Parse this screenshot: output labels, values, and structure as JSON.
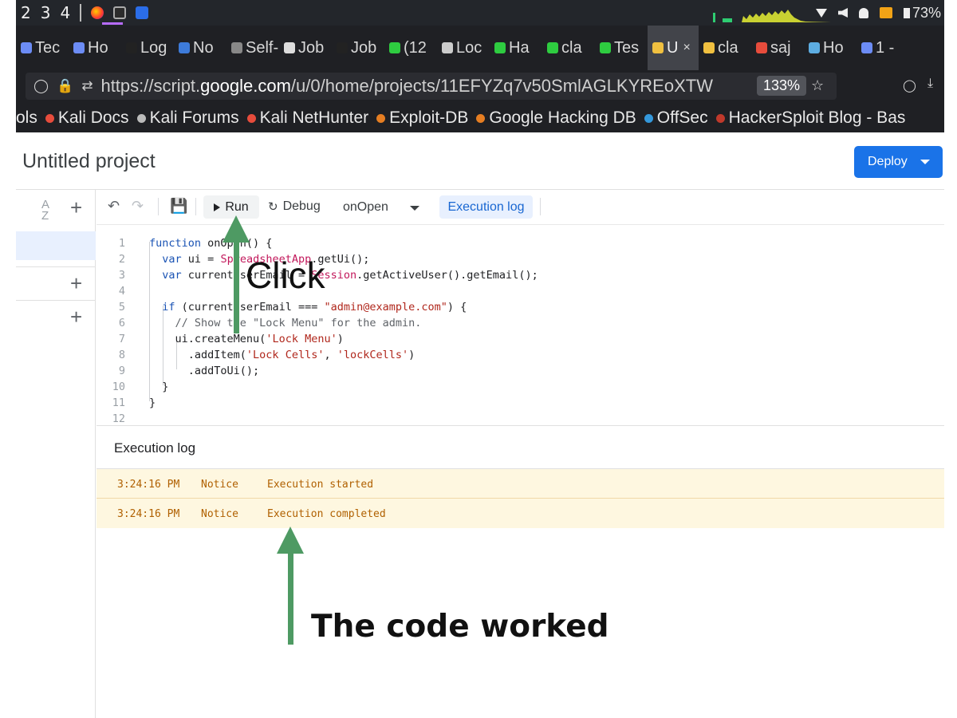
{
  "os_bar": {
    "workspaces": [
      "2",
      "3",
      "4"
    ],
    "battery": "73%"
  },
  "tabs": [
    {
      "label": "Tec",
      "color": "#6c8cf5"
    },
    {
      "label": "Ho",
      "color": "#6c8cf5"
    },
    {
      "label": "Log",
      "color": "#222"
    },
    {
      "label": "No",
      "color": "#3d7bd9"
    },
    {
      "label": "Self-",
      "color": "#888"
    },
    {
      "label": "Job",
      "color": "#ddd"
    },
    {
      "label": "Job",
      "color": "#222"
    },
    {
      "label": "(12",
      "color": "#2ecc40"
    },
    {
      "label": "Loc",
      "color": "#ccc"
    },
    {
      "label": "Ha",
      "color": "#2ecc40"
    },
    {
      "label": "cla",
      "color": "#2ecc40"
    },
    {
      "label": "Tes",
      "color": "#2ecc40"
    },
    {
      "label": "U",
      "color": "#f0c040",
      "active": true,
      "close": "×"
    },
    {
      "label": "cla",
      "color": "#f0c040"
    },
    {
      "label": "saj",
      "color": "#e74c3c"
    },
    {
      "label": "Ho",
      "color": "#5dade2"
    },
    {
      "label": "1 -",
      "color": "#6c8cf5"
    }
  ],
  "url_bar": {
    "prefix": "https://script.",
    "domain": "google.com",
    "path": "/u/0/home/projects/11EFYZq7v50SmlAGLKYREoXTW",
    "zoom": "133%"
  },
  "bookmarks": [
    {
      "label": "ols",
      "color": ""
    },
    {
      "label": "Kali Docs",
      "color": "#e74c3c"
    },
    {
      "label": "Kali Forums",
      "color": "#bbb"
    },
    {
      "label": "Kali NetHunter",
      "color": "#e74c3c"
    },
    {
      "label": "Exploit-DB",
      "color": "#e67e22"
    },
    {
      "label": "Google Hacking DB",
      "color": "#e67e22"
    },
    {
      "label": "OffSec",
      "color": "#3498db"
    },
    {
      "label": "HackerSploit Blog - Bas",
      "color": "#c0392b"
    }
  ],
  "app": {
    "project_title": "Untitled project",
    "deploy_label": "Deploy",
    "toolbar": {
      "run_label": "Run",
      "debug_label": "Debug",
      "function_name": "onOpen",
      "exec_log_label": "Execution log"
    }
  },
  "code_lines": [
    {
      "n": "1",
      "html": "<span class='kw'>function</span> onOpen() {"
    },
    {
      "n": "2",
      "html": "  <span class='kw'>var</span> ui = <span class='cls'>SpreadsheetApp</span>.getUi();"
    },
    {
      "n": "3",
      "html": "  <span class='kw'>var</span> currentUserEmail = <span class='cls'>Session</span>.getActiveUser().getEmail();"
    },
    {
      "n": "4",
      "html": ""
    },
    {
      "n": "5",
      "html": "  <span class='kw'>if</span> (currentUserEmail === <span class='str'>\"admin@example.com\"</span>) {"
    },
    {
      "n": "6",
      "html": "    <span class='cm'>// Show the \"Lock Menu\" for the admin.</span>"
    },
    {
      "n": "7",
      "html": "    ui.createMenu(<span class='str'>'Lock Menu'</span>)"
    },
    {
      "n": "8",
      "html": "      .addItem(<span class='str'>'Lock Cells'</span>, <span class='str'>'lockCells'</span>)"
    },
    {
      "n": "9",
      "html": "      .addToUi();"
    },
    {
      "n": "10",
      "html": "  }"
    },
    {
      "n": "11",
      "html": "}"
    },
    {
      "n": "12",
      "html": ""
    }
  ],
  "execution_log": {
    "title": "Execution log",
    "rows": [
      {
        "time": "3:24:16 PM",
        "level": "Notice",
        "message": "Execution started"
      },
      {
        "time": "3:24:16 PM",
        "level": "Notice",
        "message": "Execution completed"
      }
    ]
  },
  "annotations": {
    "click_label": "Click",
    "worked_label": "The code worked",
    "arrow_color": "#4e9a63"
  }
}
